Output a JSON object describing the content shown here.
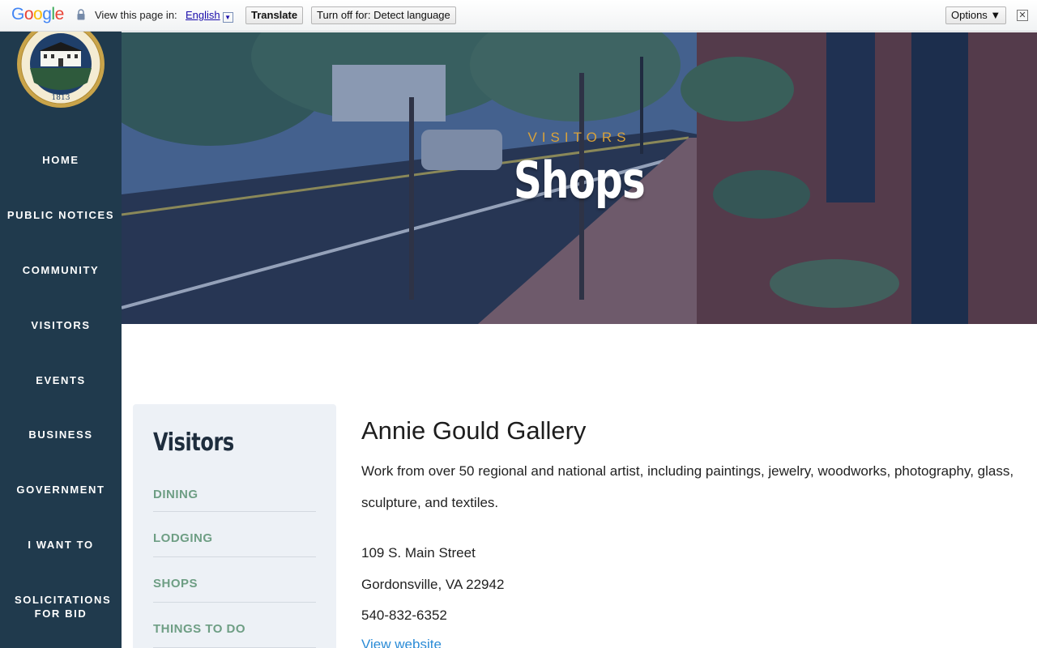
{
  "translate_bar": {
    "logo": "Google",
    "prompt": "View this page in:",
    "language": "English",
    "translate_label": "Translate",
    "turn_off_label": "Turn off for: Detect language",
    "options_label": "Options ▼",
    "close_glyph": "✕"
  },
  "sidebar": {
    "seal_year": "1813",
    "items": [
      {
        "label": "HOME"
      },
      {
        "label": "PUBLIC NOTICES"
      },
      {
        "label": "COMMUNITY"
      },
      {
        "label": "VISITORS"
      },
      {
        "label": "EVENTS"
      },
      {
        "label": "BUSINESS"
      },
      {
        "label": "GOVERNMENT"
      },
      {
        "label": "I WANT TO"
      },
      {
        "label": "SOLICITATIONS FOR BID"
      }
    ]
  },
  "hero": {
    "eyebrow": "VISITORS",
    "title": "Shops"
  },
  "subnav": {
    "title": "Visitors",
    "items": [
      {
        "label": "DINING"
      },
      {
        "label": "LODGING"
      },
      {
        "label": "SHOPS"
      },
      {
        "label": "THINGS TO DO"
      }
    ]
  },
  "listing": {
    "name": "Annie Gould Gallery",
    "description": "Work from over 50 regional and national artist, including  paintings, jewelry, woodworks, photography, glass, sculpture, and textiles.",
    "street": "109 S. Main Street",
    "city": "Gordonsville, VA 22942",
    "phone": "540-832-6352",
    "website_label": "View website"
  },
  "colors": {
    "sidebar_bg": "#203a4d",
    "accent_gold": "#d9a23a",
    "subnav_link": "#6e9e84",
    "link_blue": "#2a8bd6"
  }
}
